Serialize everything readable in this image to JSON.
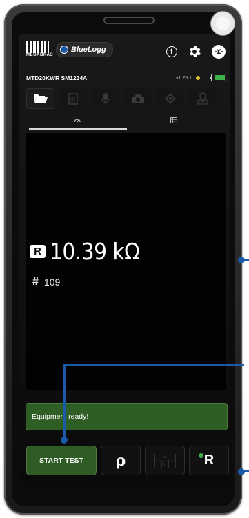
{
  "header": {
    "brand_label": "MEGABRAS",
    "app_name": "BlueLogg",
    "info_label": "i"
  },
  "device": {
    "id": "MTD20KWR SM1234A",
    "version": "v1.25.1",
    "battery_level": 0.85
  },
  "toolbar": {
    "items": [
      "folder-open-icon",
      "document-icon",
      "microphone-icon",
      "camera-icon",
      "gps-icon",
      "map-pin-icon"
    ],
    "active_index": 0
  },
  "tabs": [
    "gauge-icon",
    "grid-icon"
  ],
  "reading": {
    "mode_badge": "R",
    "value": "10.39 kΩ",
    "count_symbol": "#",
    "count": "109"
  },
  "status": {
    "message": "Equipment ready!"
  },
  "actions": {
    "start_label": "START TEST",
    "rho_label": "ρ",
    "r_label": "R"
  },
  "colors": {
    "accent_green": "#2e5c24",
    "callout_blue": "#1b5aa6",
    "status_yellow": "#e0c02a",
    "battery_green": "#3db24a"
  }
}
